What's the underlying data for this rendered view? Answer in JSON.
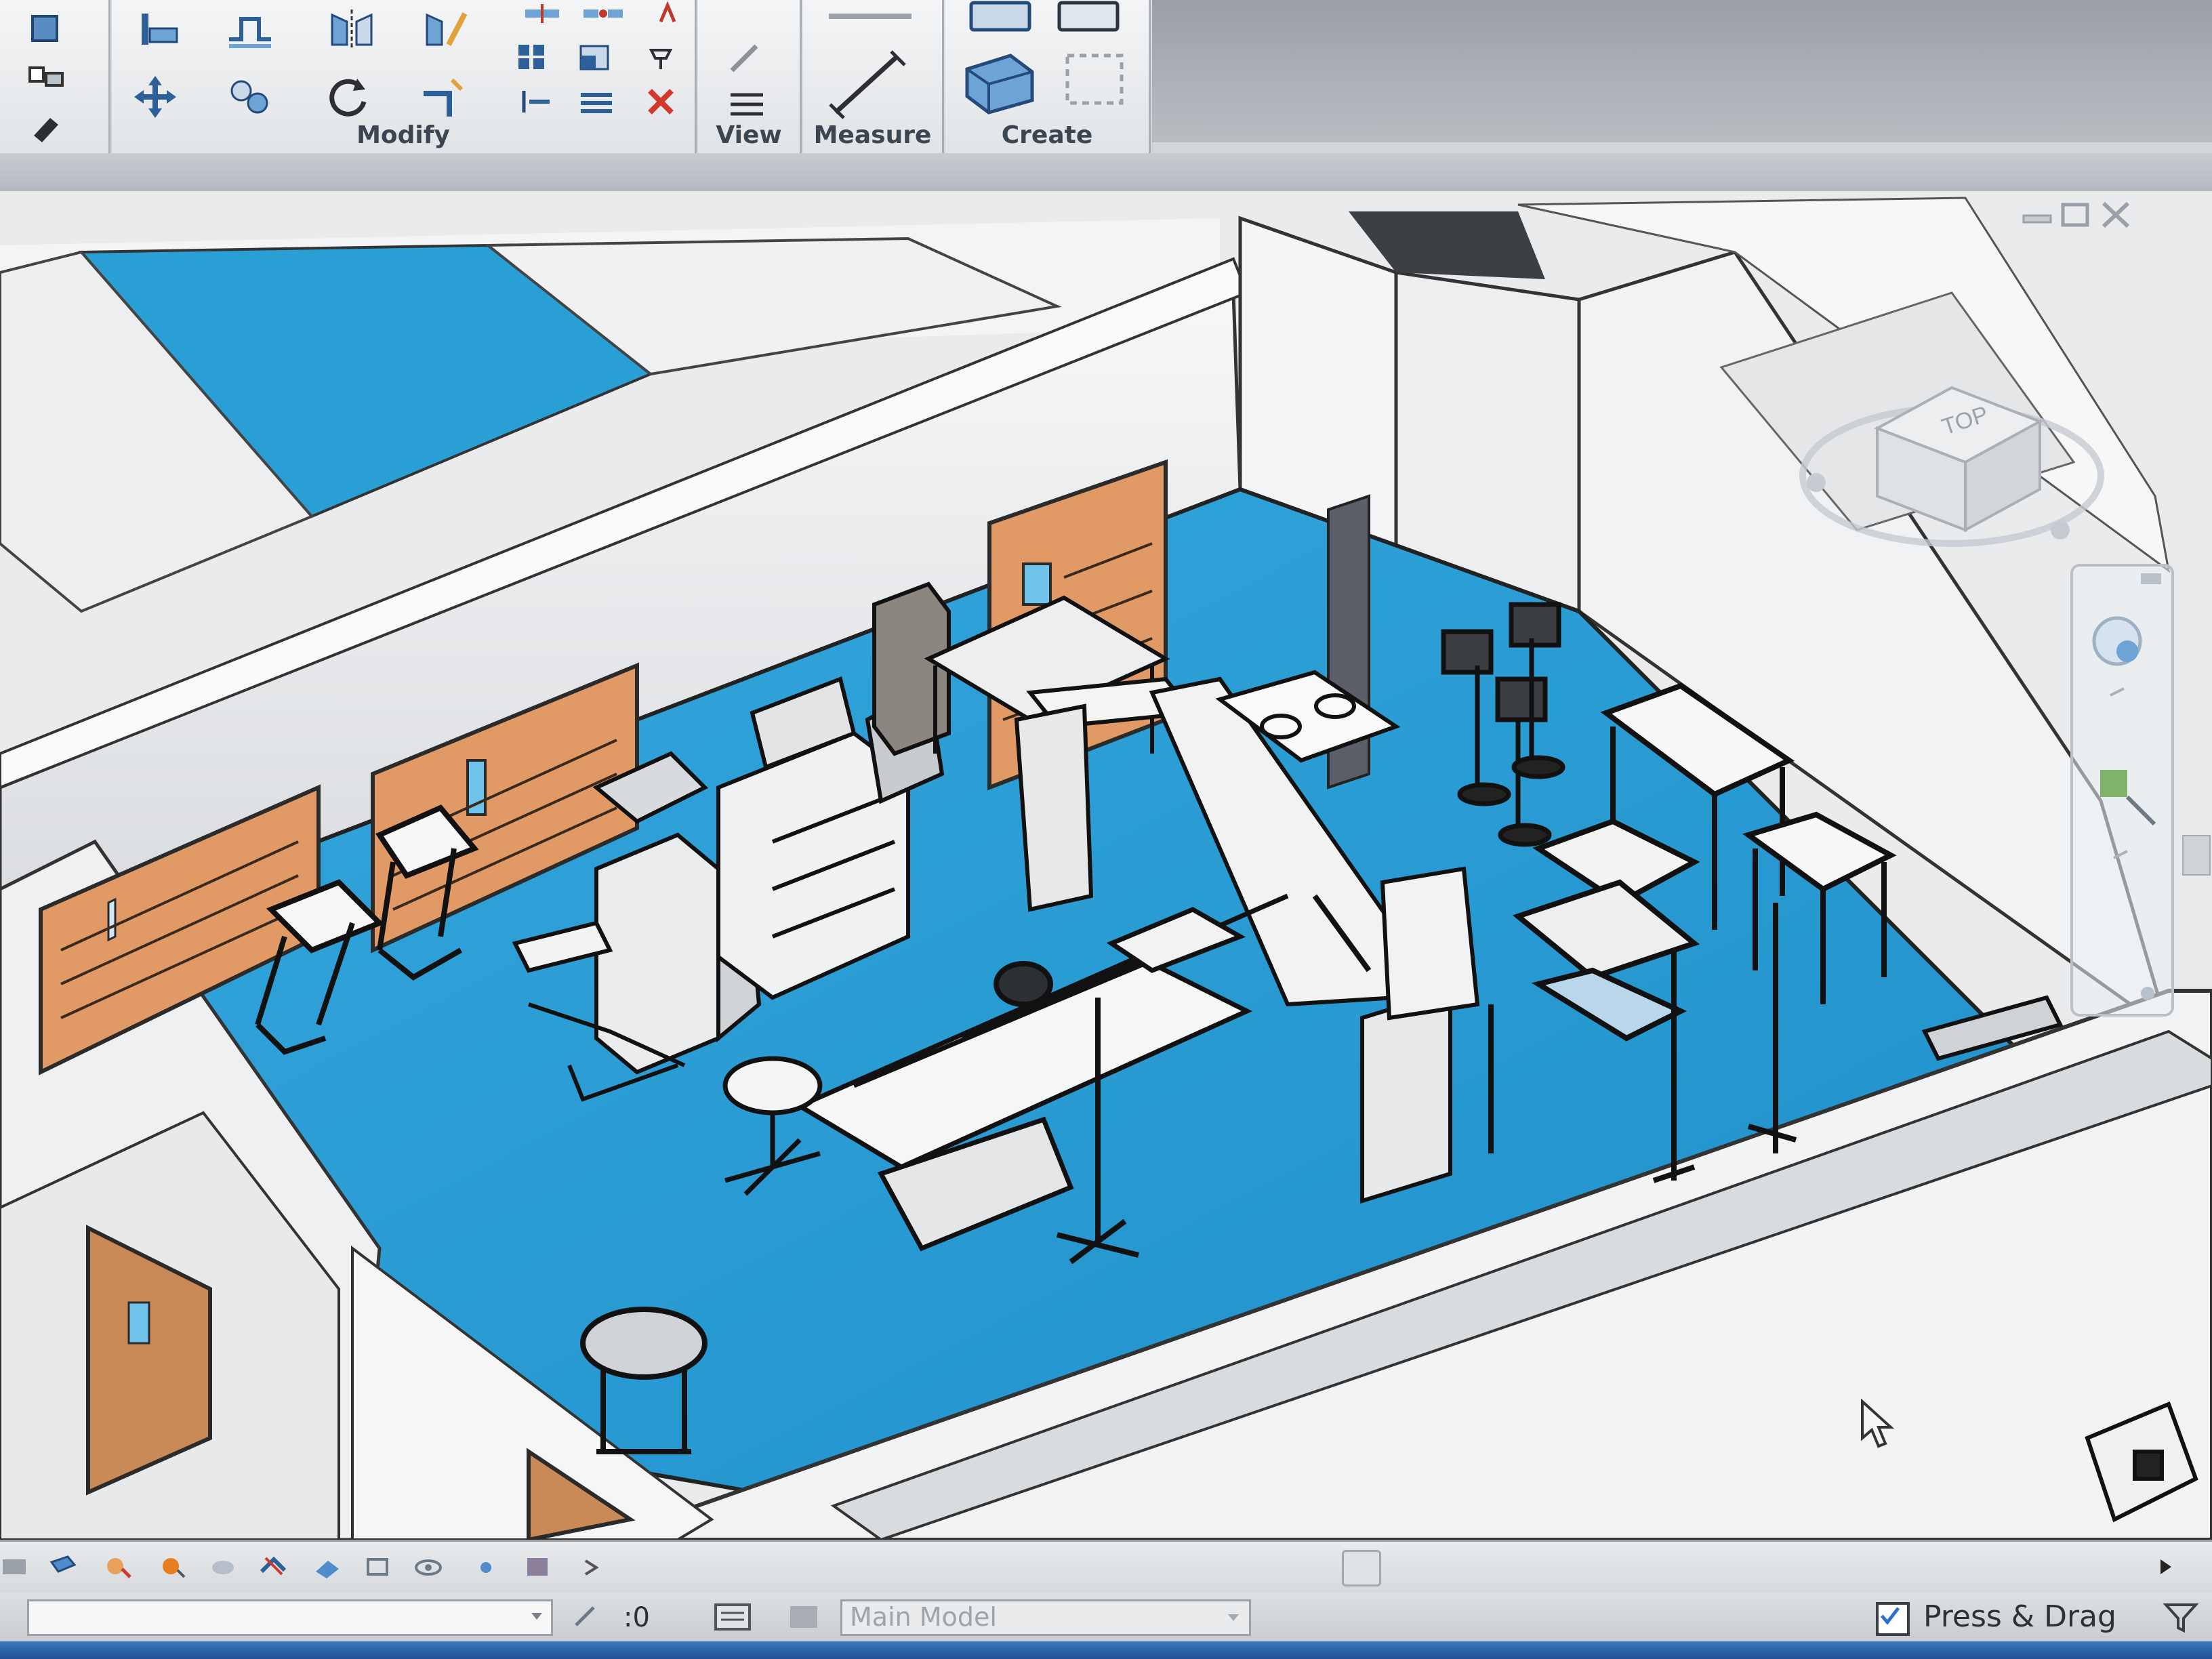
{
  "ribbon": {
    "panels": [
      {
        "id": "modify",
        "label": "Modify"
      },
      {
        "id": "view",
        "label": "View"
      },
      {
        "id": "measure",
        "label": "Measure"
      },
      {
        "id": "create",
        "label": "Create"
      }
    ],
    "tools": [
      "align-icon",
      "offset-icon",
      "mirror-pick-axis-icon",
      "mirror-draw-axis-icon",
      "move-icon",
      "copy-icon",
      "rotate-icon",
      "trim-extend-icon",
      "split-icon",
      "array-icon",
      "scale-icon",
      "pin-icon",
      "unpin-icon",
      "delete-icon",
      "measure-icon",
      "create-assembly-icon",
      "create-parts-icon",
      "create-group-icon"
    ]
  },
  "viewport": {
    "viewcube_face": "TOP",
    "floor_color": "#2a9fd6",
    "door_color": "#e19a66",
    "wall_color": "#eef0f2"
  },
  "view_control_bar": {
    "icons": [
      "scale-icon",
      "detail-level-icon",
      "visual-style-icon",
      "sun-path-icon",
      "shadows-icon",
      "render-icon",
      "crop-view-icon",
      "show-crop-icon",
      "temporary-hide-icon",
      "reveal-hidden-icon",
      "worksharing-icon",
      "analytical-model-icon"
    ]
  },
  "status_bar": {
    "workset_value": ":0",
    "design_option": "Main Model",
    "press_drag_label": "Press & Drag",
    "press_drag_checked": true
  }
}
